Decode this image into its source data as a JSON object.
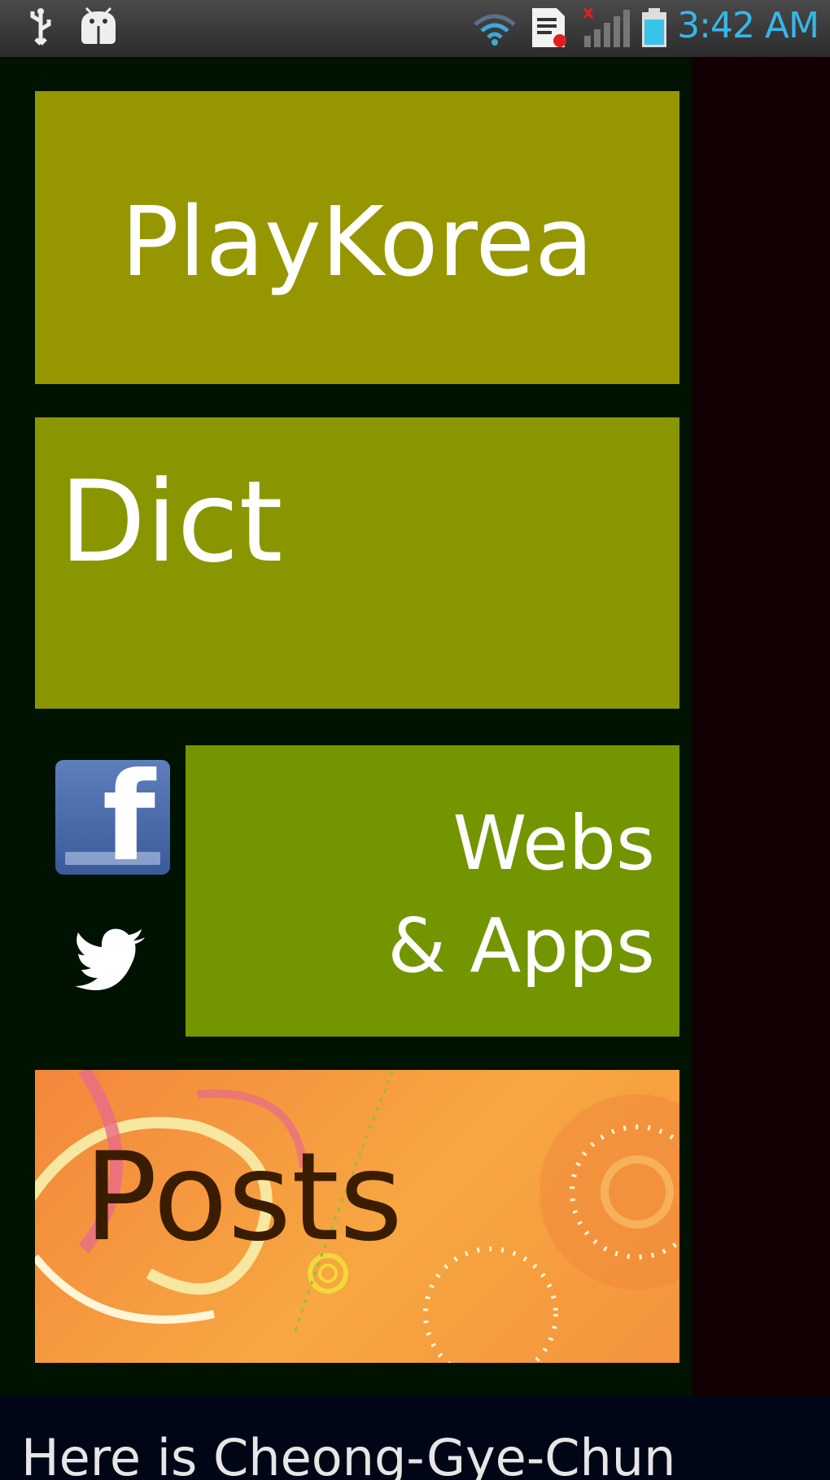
{
  "status_bar": {
    "time": "3:42 AM",
    "icons": [
      "usb-icon",
      "android-debug-icon",
      "wifi-icon",
      "sim-card-icon",
      "signal-icon",
      "battery-icon"
    ]
  },
  "tiles": {
    "playkorea": {
      "label": "PlayKorea",
      "color": "#969700"
    },
    "dict": {
      "label": "Dict",
      "color": "#8a9600"
    },
    "webs_apps": {
      "line1": "Webs",
      "line2": "& Apps",
      "color": "#739500"
    },
    "posts": {
      "label": "Posts",
      "color": "#f3873b"
    }
  },
  "social": {
    "facebook_icon": "facebook-icon",
    "twitter_icon": "twitter-icon"
  },
  "footer": {
    "caption": "Here is Cheong-Gye-Chun"
  }
}
